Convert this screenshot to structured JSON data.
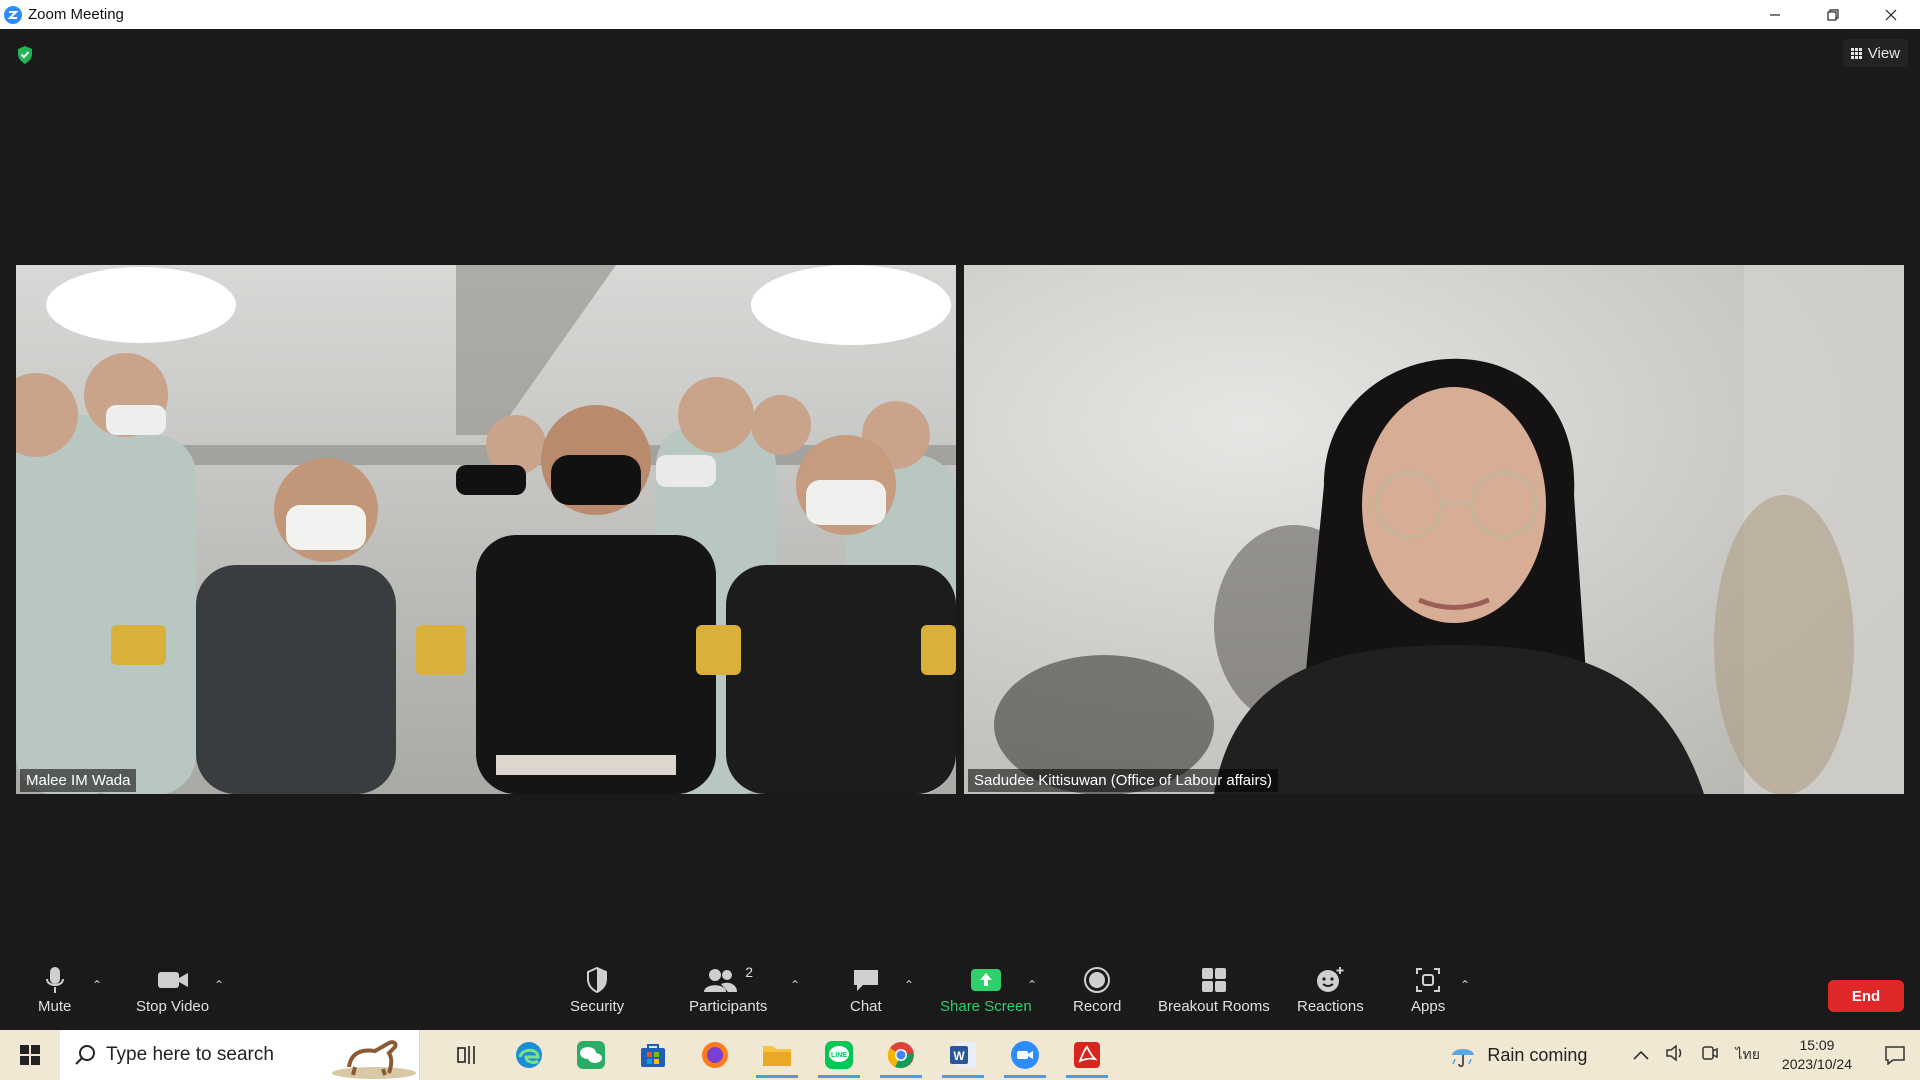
{
  "window": {
    "title": "Zoom Meeting",
    "controls": [
      "minimize",
      "restore",
      "close"
    ]
  },
  "meeting": {
    "view_label": "View",
    "participants": [
      {
        "name": "Malee IM Wada"
      },
      {
        "name": "Sadudee Kittisuwan (Office of Labour affairs)"
      }
    ]
  },
  "toolbar": {
    "mute_label": "Mute",
    "stop_video_label": "Stop Video",
    "security_label": "Security",
    "participants_label": "Participants",
    "participants_count": "2",
    "chat_label": "Chat",
    "share_screen_label": "Share Screen",
    "record_label": "Record",
    "breakout_label": "Breakout Rooms",
    "reactions_label": "Reactions",
    "apps_label": "Apps",
    "end_label": "End"
  },
  "taskbar": {
    "search_placeholder": "Type here to search",
    "weather_text": "Rain coming",
    "input_language": "ไทย",
    "time": "15:09",
    "date": "2023/10/24",
    "pinned_apps": [
      "task-view",
      "edge",
      "wechat",
      "store",
      "firefox",
      "file-explorer",
      "line",
      "chrome",
      "word",
      "zoom",
      "acrobat"
    ]
  },
  "colors": {
    "zoom_blue": "#2d8cff",
    "end_red": "#e02828",
    "share_green": "#2fcf6c",
    "taskbar_bg": "#f1e8d4"
  }
}
